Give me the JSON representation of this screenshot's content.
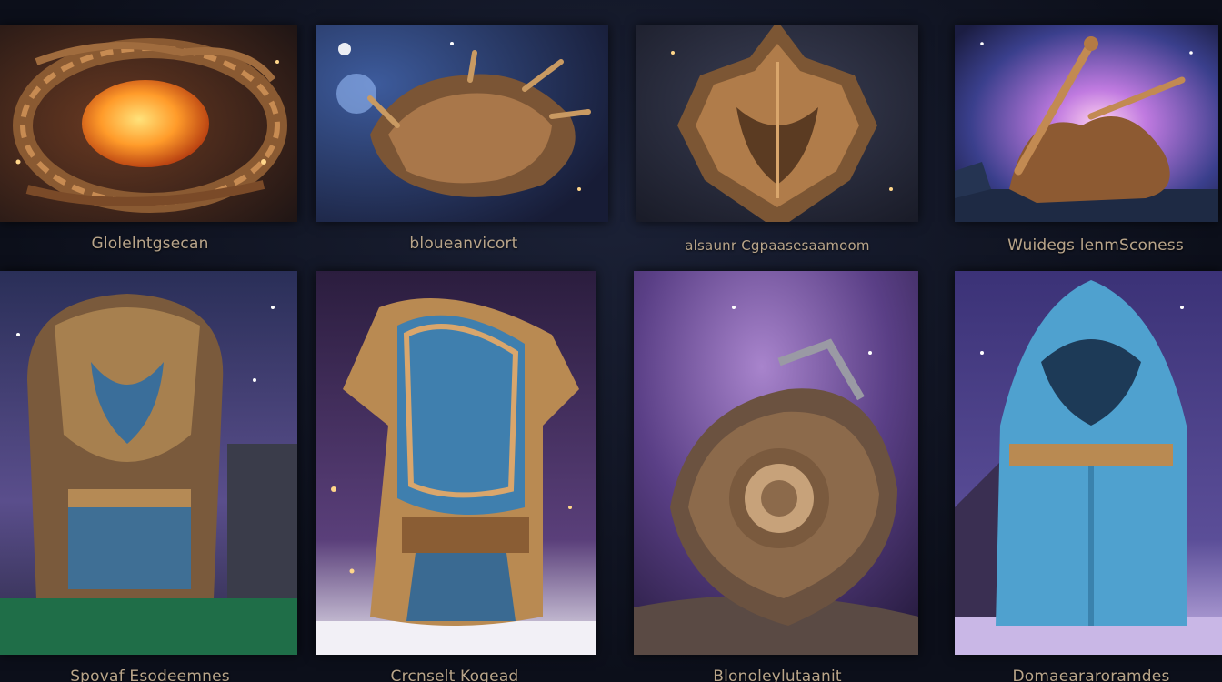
{
  "gallery": {
    "row1": [
      {
        "caption": "Glolelntgsecan",
        "icon": "glowing-orb-armor-icon"
      },
      {
        "caption": "bloueanvicort",
        "icon": "bronze-creature-armor-icon"
      },
      {
        "caption": "alsaunr Cgpaasesaamoom",
        "icon": "bronze-helm-icon"
      },
      {
        "caption": "Wuidegs lenmSconess",
        "icon": "bronze-siege-weapon-icon"
      }
    ],
    "row2": [
      {
        "caption": "Spovaf Esodeemnes",
        "icon": "blue-gold-armor-icon"
      },
      {
        "caption": "Crcnselt Kogead",
        "icon": "hooded-blue-tunic-icon"
      },
      {
        "caption": "Blonoleylutaanit",
        "icon": "spiral-shield-armor-icon"
      },
      {
        "caption": "Domaeararoramdes",
        "icon": "blue-hooded-robe-icon"
      }
    ]
  },
  "colors": {
    "gold": "#b98a52",
    "blue": "#3f87b8",
    "purple": "#6a4f9a",
    "background": "#0e1220"
  }
}
